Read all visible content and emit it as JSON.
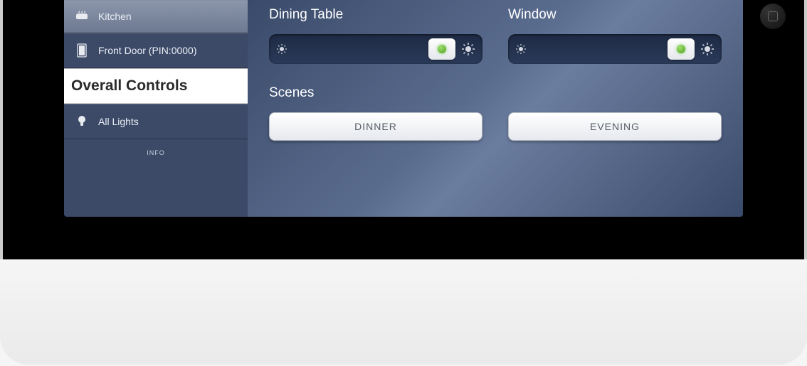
{
  "sidebar": {
    "items": [
      {
        "label": "Kitchen",
        "icon": "kitchen"
      },
      {
        "label": "Front Door (PIN:0000)",
        "icon": "door"
      }
    ],
    "section_header": "Overall Controls",
    "overall_items": [
      {
        "label": "All Lights",
        "icon": "bulb"
      }
    ],
    "info_label": "INFO"
  },
  "content": {
    "controls": [
      {
        "name": "Dining Table"
      },
      {
        "name": "Window"
      }
    ],
    "scenes_title": "Scenes",
    "scenes": [
      {
        "label": "DINNER"
      },
      {
        "label": "EVENING"
      }
    ]
  }
}
